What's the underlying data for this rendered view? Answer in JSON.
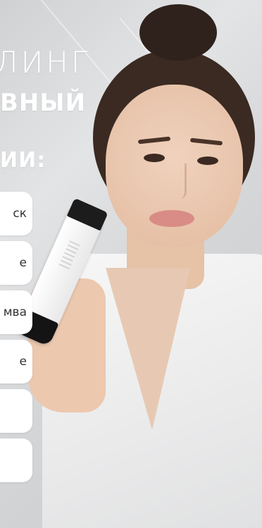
{
  "headline": {
    "line1": "ЛИНГ",
    "line2": "ВНЫЙ",
    "line3": "ИИ:"
  },
  "features": [
    {
      "label": "ск"
    },
    {
      "label": "е"
    },
    {
      "label": "мва"
    },
    {
      "label": "е"
    },
    {
      "label": ""
    },
    {
      "label": ""
    }
  ]
}
